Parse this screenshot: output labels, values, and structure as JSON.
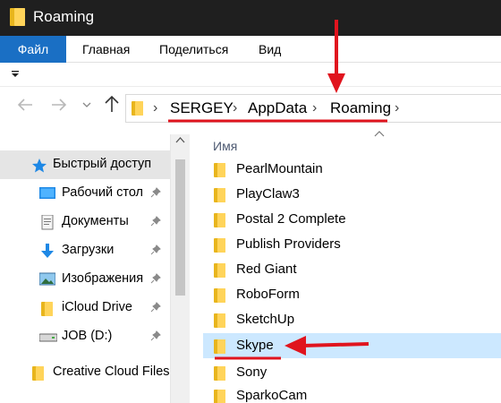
{
  "window": {
    "title": "Roaming"
  },
  "ribbon": {
    "tabs": [
      "Файл",
      "Главная",
      "Поделиться",
      "Вид"
    ]
  },
  "qat": {
    "dropdown_icon": "qat-dropdown-icon"
  },
  "nav": {
    "back_icon": "arrow-left-icon",
    "forward_icon": "arrow-right-icon",
    "history_icon": "chevron-down-icon",
    "up_icon": "arrow-up-icon"
  },
  "address": {
    "crumbs": [
      "SERGEY",
      "AppData",
      "Roaming"
    ]
  },
  "columns": {
    "name": "Имя"
  },
  "sidebar": {
    "items": [
      {
        "label": "Быстрый доступ",
        "icon": "star-icon",
        "selected": true,
        "pinned": false
      },
      {
        "label": "Рабочий стол",
        "icon": "desktop-icon",
        "pinned": true
      },
      {
        "label": "Документы",
        "icon": "documents-icon",
        "pinned": true
      },
      {
        "label": "Загрузки",
        "icon": "download-icon",
        "pinned": true
      },
      {
        "label": "Изображения",
        "icon": "pictures-icon",
        "pinned": true
      },
      {
        "label": "iCloud Drive",
        "icon": "folder-icon",
        "pinned": true
      },
      {
        "label": "JOB (D:)",
        "icon": "drive-icon",
        "pinned": true
      },
      {
        "label": "Creative Cloud Files",
        "icon": "folder-icon",
        "pinned": false
      }
    ]
  },
  "files": [
    {
      "name": "PearlMountain"
    },
    {
      "name": "PlayClaw3"
    },
    {
      "name": "Postal 2 Complete"
    },
    {
      "name": "Publish Providers"
    },
    {
      "name": "Red Giant"
    },
    {
      "name": "RoboForm"
    },
    {
      "name": "SketchUp"
    },
    {
      "name": "Skype",
      "selected": true
    },
    {
      "name": "Sony"
    },
    {
      "name": "SparkoCam"
    }
  ],
  "colors": {
    "annotation_red": "#e0141e",
    "selection": "#cce8ff",
    "file_tab": "#1a6fc4"
  }
}
